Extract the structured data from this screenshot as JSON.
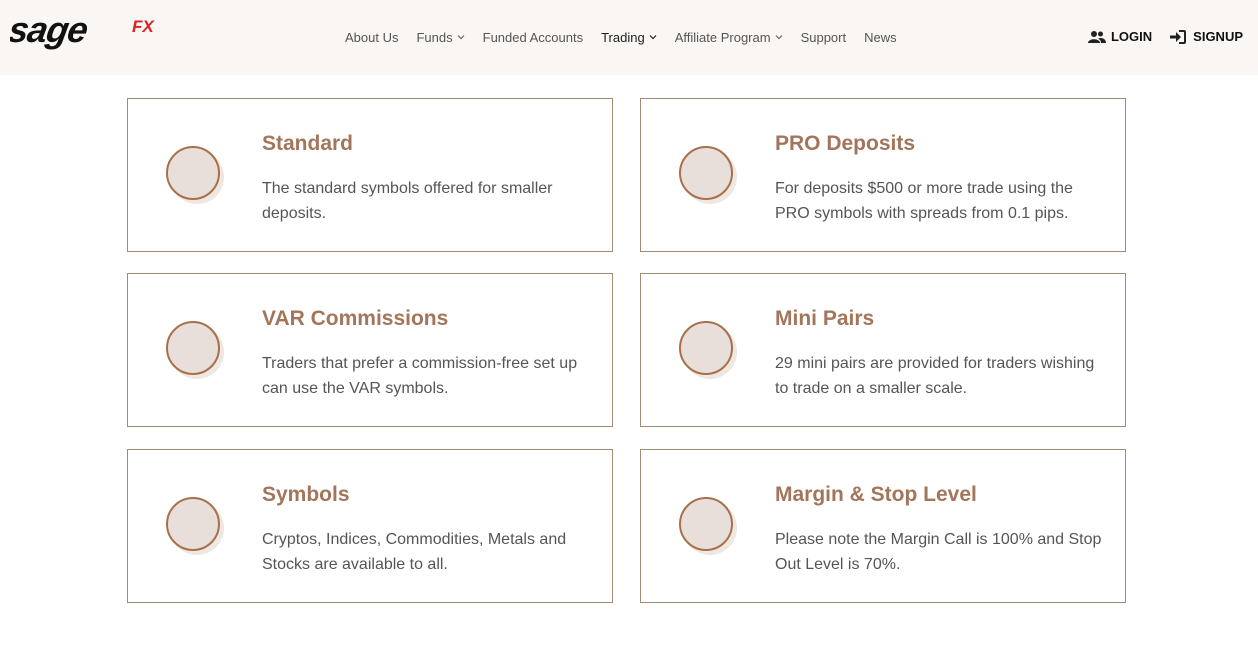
{
  "brand": {
    "logo_text": "sage",
    "logo_suffix": "FX",
    "accent_color": "#e02020"
  },
  "nav": {
    "items": [
      {
        "label": "About Us",
        "dropdown": false,
        "active": false
      },
      {
        "label": "Funds",
        "dropdown": true,
        "active": false
      },
      {
        "label": "Funded Accounts",
        "dropdown": false,
        "active": false
      },
      {
        "label": "Trading",
        "dropdown": true,
        "active": true
      },
      {
        "label": "Affiliate Program",
        "dropdown": true,
        "active": false
      },
      {
        "label": "Support",
        "dropdown": false,
        "active": false
      },
      {
        "label": "News",
        "dropdown": false,
        "active": false
      }
    ]
  },
  "auth": {
    "login_label": "LOGIN",
    "login_icon": "users-icon",
    "signup_label": "SIGNUP",
    "signup_icon": "sign-in-icon"
  },
  "cards": [
    {
      "title": "Standard",
      "description": "The standard symbols offered for smaller deposits."
    },
    {
      "title": "PRO Deposits",
      "description": "For deposits $500 or more trade using the PRO symbols with spreads from 0.1 pips."
    },
    {
      "title": "VAR Commissions",
      "description": "Traders that prefer a commission-free set up can use the VAR symbols."
    },
    {
      "title": "Mini Pairs",
      "description": "29 mini pairs are provided for traders wishing to trade on a smaller scale."
    },
    {
      "title": "Symbols",
      "description": "Cryptos, Indices, Commodities, Metals and Stocks are available to all."
    },
    {
      "title": "Margin & Stop Level",
      "description": "Please note the Margin Call is 100% and Stop Out Level is 70%."
    }
  ],
  "colors": {
    "card_border": "#a48a72",
    "card_title": "#a3755a",
    "circle_ring": "#a7704a",
    "circle_fill": "#e9dfda",
    "header_bg": "#f9f6f3"
  }
}
